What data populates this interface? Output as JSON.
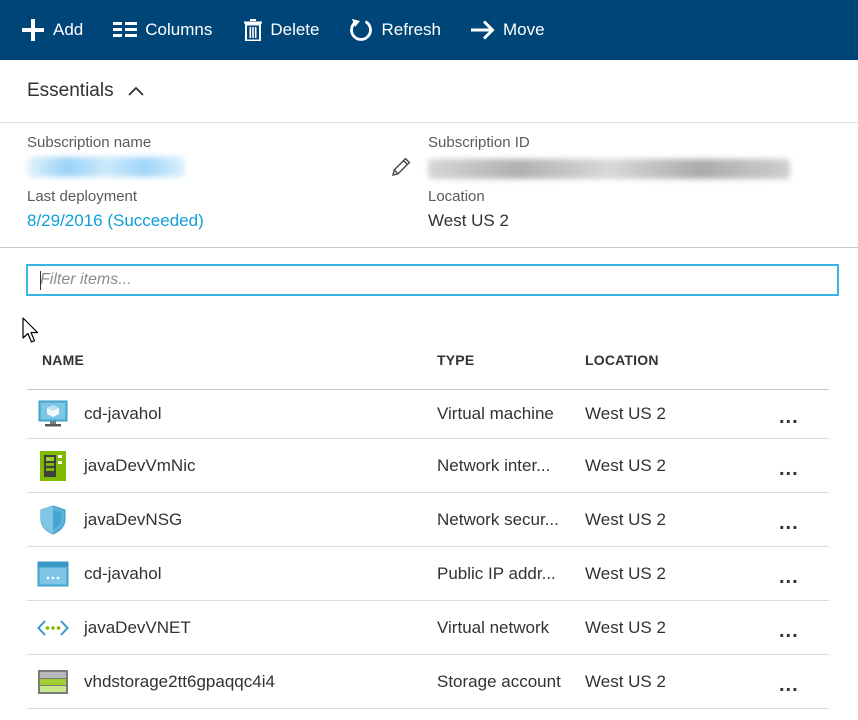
{
  "toolbar": {
    "add": "Add",
    "columns": "Columns",
    "delete": "Delete",
    "refresh": "Refresh",
    "move": "Move",
    "background": "#004578"
  },
  "essentials": {
    "title": "Essentials",
    "subscription_name_label": "Subscription name",
    "subscription_id_label": "Subscription ID",
    "last_deployment_label": "Last deployment",
    "last_deployment_value": "8/29/2016 (Succeeded)",
    "location_label": "Location",
    "location_value": "West US 2",
    "link_color": "#0e9fd8"
  },
  "filter": {
    "placeholder": "Filter items...",
    "value": ""
  },
  "table": {
    "columns": {
      "name": "NAME",
      "type": "TYPE",
      "location": "LOCATION"
    },
    "rows": [
      {
        "icon": "virtual-machine-icon",
        "name": "cd-javahol",
        "type": "Virtual machine",
        "location": "West US 2",
        "more": "..."
      },
      {
        "icon": "network-interface-icon",
        "name": "javaDevVmNic",
        "type": "Network inter...",
        "location": "West US 2",
        "more": "..."
      },
      {
        "icon": "network-security-group-icon",
        "name": "javaDevNSG",
        "type": "Network secur...",
        "location": "West US 2",
        "more": "..."
      },
      {
        "icon": "public-ip-icon",
        "name": "cd-javahol",
        "type": "Public IP addr...",
        "location": "West US 2",
        "more": "..."
      },
      {
        "icon": "virtual-network-icon",
        "name": "javaDevVNET",
        "type": "Virtual network",
        "location": "West US 2",
        "more": "..."
      },
      {
        "icon": "storage-account-icon",
        "name": "vhdstorage2tt6gpaqqc4i4",
        "type": "Storage account",
        "location": "West US 2",
        "more": "..."
      }
    ]
  },
  "icons": {
    "add": "plus-icon",
    "columns": "columns-icon",
    "delete": "trash-icon",
    "refresh": "refresh-icon",
    "move": "arrow-right-icon",
    "collapse": "chevron-up-icon",
    "edit": "pencil-icon",
    "cursor": "mouse-pointer-icon"
  }
}
